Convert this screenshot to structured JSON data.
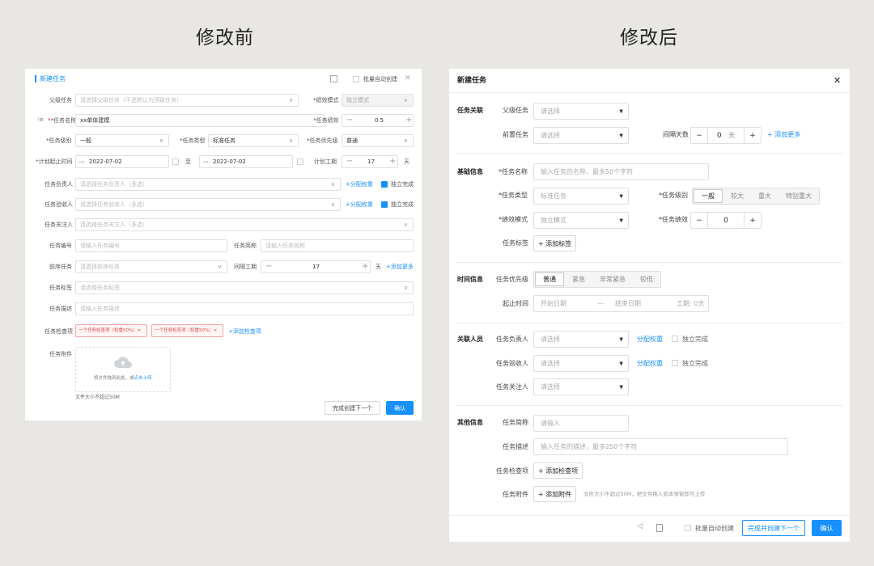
{
  "captions": {
    "before": "修改前",
    "after": "修改后"
  },
  "left": {
    "title": "新建任务",
    "batch_create": "批量自动创建",
    "close": "✕",
    "parent_label": "父级任务",
    "parent_ph": "请选择父级任务（不选默认为顶级任务）",
    "perf_mode_label": "*绩效模式",
    "perf_mode_value": "独立模式",
    "name_label": "*任务名称",
    "name_value": "xx单体建模",
    "perf_label": "*任务绩效",
    "perf_value": "0.5",
    "level_label": "*任务级别",
    "level_value": "一般",
    "type_label": "*任务类型",
    "type_value": "标准任务",
    "priority_label": "*任务优先级",
    "priority_value": "普通",
    "time_label": "*计划起止时间",
    "start_date": "2022-07-02",
    "to": "至",
    "end_date": "2022-07-02",
    "plan_hours_label": "计划工期",
    "plan_hours_value": "17",
    "day_unit": "天",
    "owner_label": "任务负责人",
    "owner_ph": "请选择任务负责人（多选）",
    "assign_weight": "+分配权重",
    "independent": "独立完成",
    "checker_label": "任务验收人",
    "checker_ph": "请选择任务验收人（多选）",
    "follower_label": "任务关注人",
    "follower_ph": "请选择任务关注人（多选）",
    "code_label": "任务编号",
    "code_ph": "请输入任务编号",
    "short_label": "任务简称",
    "short_ph": "请输入任务简称",
    "pre_label": "前序任务",
    "pre_ph": "请选择前序任务",
    "gap_label": "间隔工期",
    "gap_value": "17",
    "add_more": "+添加更多",
    "tag_label": "任务标签",
    "tag_ph": "请选择任务标签",
    "desc_label": "任务描述",
    "desc_ph": "请输入任务描述",
    "check_label": "任务检查项",
    "check_tags": [
      "一个任务检查项（权重50%）×",
      "一个任务检查项（权重50%）×"
    ],
    "add_check": "+添加检查项",
    "attach_label": "任务附件",
    "upload_text": "将文件拖到此处，或",
    "upload_link": "点击上传",
    "size_note": "文件大小不超过50M",
    "btn_next": "完成创建下一个",
    "btn_ok": "确认"
  },
  "right": {
    "title": "新建任务",
    "close": "✕",
    "sec_relation": "任务关联",
    "parent_label": "父级任务",
    "select_ph": "请选择",
    "pre_label": "前置任务",
    "gap_label": "间隔天数",
    "gap_value": "0",
    "day": "天",
    "add_more": "添加更多",
    "sec_basic": "基础信息",
    "name_label": "*任务名称",
    "name_ph": "输入任务的名称，最多50个字符",
    "type_label": "*任务类型",
    "type_value": "标准任务",
    "level_label": "*任务级别",
    "levels": [
      "一般",
      "较大",
      "重大",
      "特别重大"
    ],
    "mode_label": "*绩效模式",
    "mode_value": "独立模式",
    "perf_label": "*任务绩效",
    "perf_value": "0",
    "tag_label": "任务标签",
    "add_tag": "添加标签",
    "sec_time": "时间信息",
    "priority_label": "任务优先级",
    "priorities": [
      "普通",
      "紧急",
      "非常紧急",
      "较低"
    ],
    "range_label": "起止时间",
    "start_ph": "开始日期",
    "dash": "—",
    "end_ph": "结束日期",
    "hours": "工期: 0天",
    "sec_people": "关联人员",
    "owner_label": "任务负责人",
    "assign_weight": "分配权重",
    "independent": "独立完成",
    "checker_label": "任务验收人",
    "follower_label": "任务关注人",
    "sec_other": "其他信息",
    "short_label": "任务简称",
    "short_ph": "请输入",
    "desc_label": "任务描述",
    "desc_ph": "输入任务的描述，最多250个字符",
    "check_label": "任务检查项",
    "add_check": "添加检查项",
    "attach_label": "任务附件",
    "add_attach": "添加附件",
    "attach_note": "文件大小不超过50M，把文件拖入到本弹窗即可上传",
    "batch_create": "批量自动创建",
    "btn_next": "完成并创建下一个",
    "btn_ok": "确认"
  }
}
